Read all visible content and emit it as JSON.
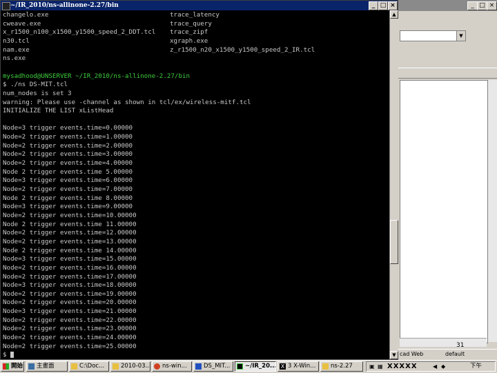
{
  "terminal": {
    "title": "~/IR_2010/ns-allinone-2.27/bin",
    "files_left": [
      "changelo.exe",
      "cweave.exe",
      "x_r1500_n100_x1500_y1500_speed_2_DDT.tcl",
      "n30.tcl",
      "nam.exe",
      "ns.exe"
    ],
    "files_right": [
      "trace_latency",
      "trace_query",
      "trace_zipf",
      "xgraph.exe",
      "z_r1500_n20_x1500_y1500_speed_2_IR.tcl"
    ],
    "prompt": "mysadhood@UNSERVER ~/IR_2010/ns-allinone-2.27/bin",
    "command": "$ ./ns DS-MIT.tcl",
    "output": [
      "num_nodes is set 3",
      "warning: Please use -channel as shown in tcl/ex/wireless-mitf.tcl",
      "INITIALIZE THE LIST xListHead"
    ],
    "events": [
      "Node=3 trigger events.time=0.00000",
      "Node=2 trigger events.time=1.00000",
      "Node=2 trigger events.time=2.00000",
      "Node=2 trigger events.time=3.00000",
      "Node=2 trigger events.time=4.00000",
      "Node 2 trigger events.time 5.00000",
      "Node=3 trigger events.time=6.00000",
      "Node=2 trigger events.time=7.00000",
      "Node 2 trigger events.time 8.00000",
      "Node=3 trigger events.time=9.00000",
      "Node=2 trigger events.time=10.00000",
      "Node 2 trigger events.time 11.00000",
      "Node=2 trigger events.time=12.00000",
      "Node=2 trigger events.time=13.00000",
      "Node 2 trigger events.time 14.00000",
      "Node=3 trigger events.time=15.00000",
      "Node=2 trigger events.time=16.00000",
      "Node=2 trigger events.time=17.00000",
      "Node=3 trigger events.time=18.00000",
      "Node=2 trigger events.time=19.00000",
      "Node=2 trigger events.time=20.00000",
      "Node=3 trigger events.time=21.00000",
      "Node=2 trigger events.time=22.00000",
      "Node=2 trigger events.time=23.00000",
      "Node=2 trigger events.time=24.00000",
      "Node=2 trigger events.time=25.00000"
    ],
    "final_prompt": "$"
  },
  "background_window": {
    "page_number": "31",
    "status_left": "cad Web",
    "status_right": "default"
  },
  "taskbar": {
    "start_label": "開始",
    "tasks": [
      "主畫面",
      "C:\\Doc...",
      "2010-03...",
      "ns-win...",
      "DS_MIT...",
      "~/IR_20...",
      "3 X-Win...",
      "ns-2.27"
    ],
    "tray_text": "XXXXX",
    "clock": "下午"
  },
  "colors": {
    "terminal_bg": "#000000",
    "terminal_text": "#c8c8c8",
    "prompt_green": "#3fcf3f",
    "prompt_yellow": "#d8d85a",
    "titlebar": "#0a246a",
    "window_face": "#d4d0c8"
  }
}
